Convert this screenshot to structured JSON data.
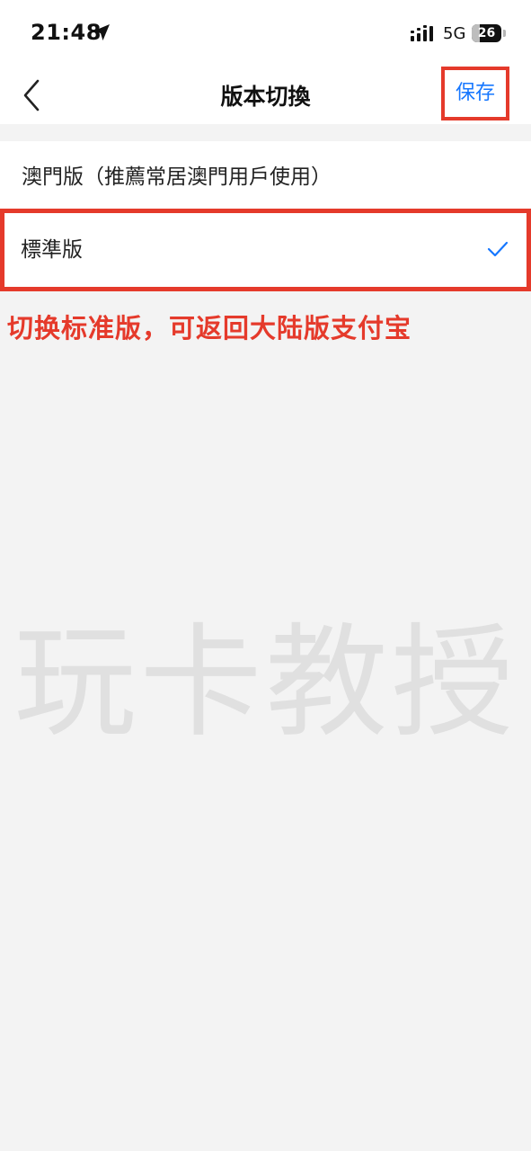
{
  "status_bar": {
    "time": "21:48",
    "network": "5G",
    "battery_level": "26",
    "battery_fraction": 0.26
  },
  "nav": {
    "back_icon": "chevron-left-icon",
    "title": "版本切換",
    "save_label": "保存"
  },
  "options": [
    {
      "label": "澳門版（推薦常居澳門用戶使用）",
      "selected": false
    },
    {
      "label": "標準版",
      "selected": true
    }
  ],
  "annotation": "切换标准版，可返回大陆版支付宝",
  "watermark": "玩卡教授",
  "colors": {
    "accent": "#1677ff",
    "highlight": "#e53a2b",
    "background": "#f3f3f3",
    "watermark": "#e0e0e0"
  }
}
